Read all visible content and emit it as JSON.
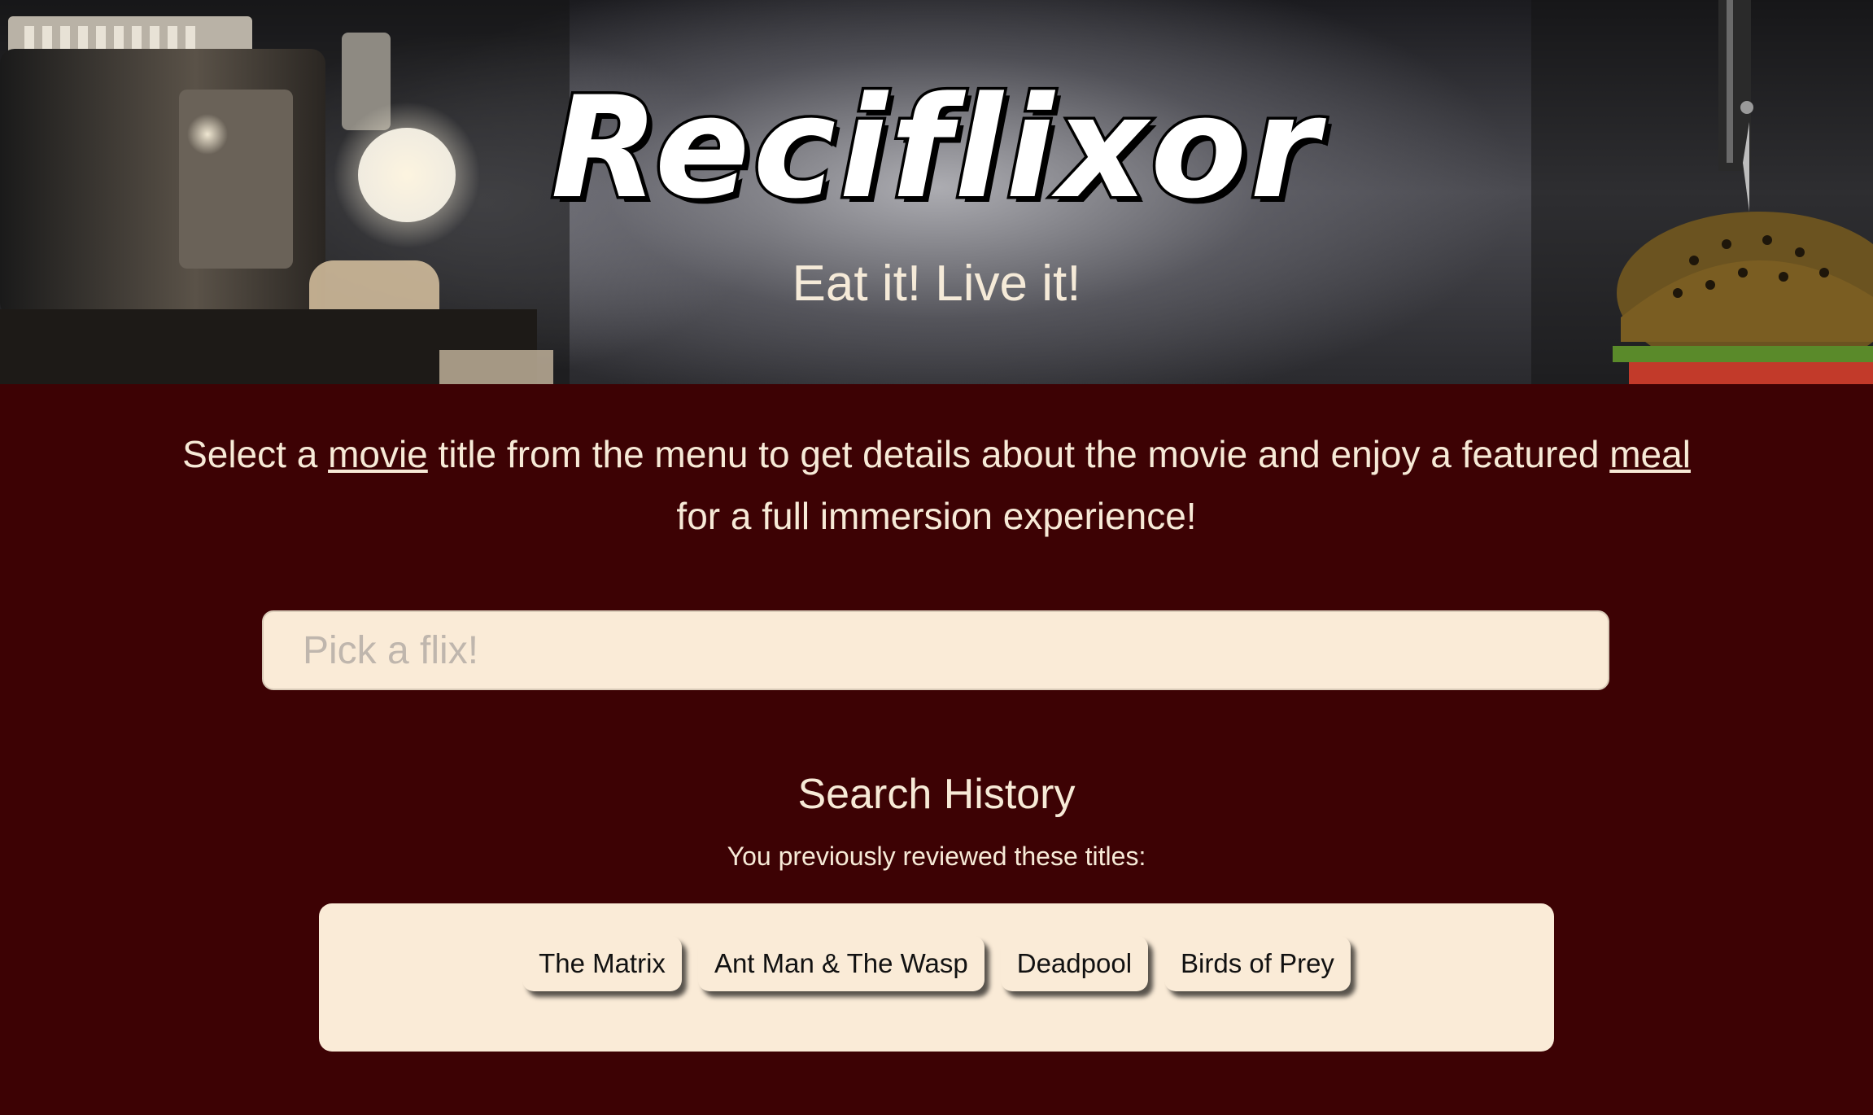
{
  "header": {
    "title": "Reciflixor",
    "tagline": "Eat it! Live it!"
  },
  "intro": {
    "part1": "Select a ",
    "movie_link": "movie",
    "part2": " title from the menu to get details about the movie and enjoy a featured ",
    "meal_link": "meal",
    "part3": " for a full immersion experience!"
  },
  "search": {
    "placeholder": "Pick a flix!",
    "value": ""
  },
  "history": {
    "title": "Search History",
    "subtitle": "You previously reviewed these titles:",
    "items": [
      {
        "label": "The Matrix"
      },
      {
        "label": "Ant Man & The Wasp"
      },
      {
        "label": "Deadpool"
      },
      {
        "label": "Birds of Prey"
      }
    ]
  },
  "colors": {
    "background": "#3d0204",
    "cream": "#faebd7",
    "text_light": "#f7ead7"
  },
  "hero_images": [
    "film-projector",
    "burger-with-knife"
  ]
}
